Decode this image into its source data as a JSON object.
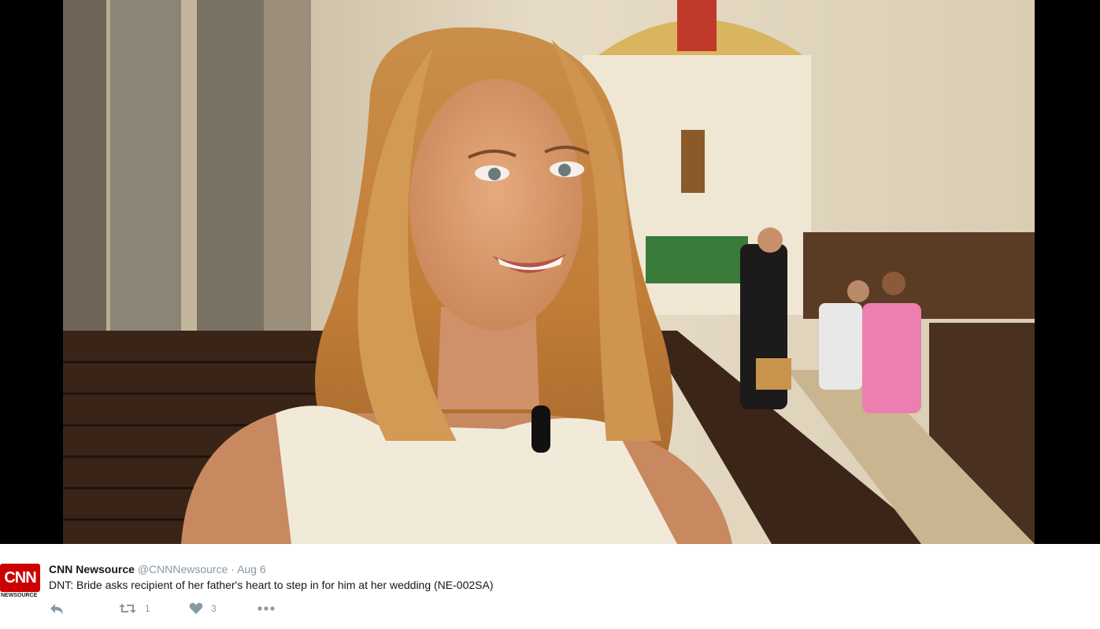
{
  "media": {
    "description_icon": "video-still"
  },
  "tweet": {
    "avatar": {
      "logo_text": "CNN",
      "logo_sub": "NEWSOURCE"
    },
    "author_name": "CNN Newsource",
    "handle": "@CNNNewsource",
    "separator": "·",
    "timestamp": "Aug 6",
    "text": "DNT: Bride asks recipient of her father's heart to step in for him at her wedding (NE-002SA)",
    "actions": {
      "reply_icon": "reply-icon",
      "retweet_icon": "retweet-icon",
      "retweet_count": "1",
      "like_icon": "heart-icon",
      "like_count": "3",
      "more_icon": "more-icon"
    }
  },
  "colors": {
    "brand_red": "#cc0000",
    "muted": "#8899a6",
    "text": "#14171a"
  }
}
